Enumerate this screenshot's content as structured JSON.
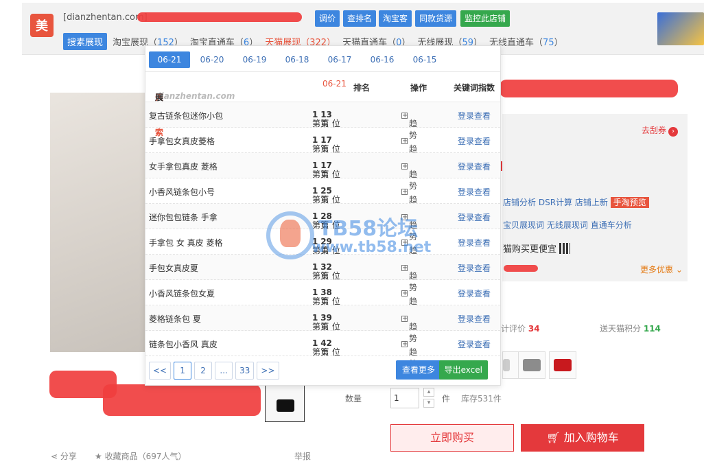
{
  "topbar": {
    "logo_char": "美",
    "domain": "[dianzhentan.com]",
    "buttons": [
      "调价",
      "查排名",
      "淘宝客",
      "同款货源",
      "监控此店铺"
    ],
    "tab_badge": "搜素展现",
    "tabs": [
      {
        "label": "淘宝展现",
        "count": "152"
      },
      {
        "label": "淘宝直通车",
        "count": "6"
      },
      {
        "label": "天猫展现",
        "count": "322",
        "active": true
      },
      {
        "label": "天猫直通车",
        "count": "0"
      },
      {
        "label": "无线展现",
        "count": "59"
      },
      {
        "label": "无线直通车",
        "count": "75"
      }
    ]
  },
  "panel": {
    "dates": [
      "06-21",
      "06-20",
      "06-19",
      "06-18",
      "06-17",
      "06-16",
      "06-15"
    ],
    "selected_date": "06-21",
    "header": {
      "site": "dianzhentan.com",
      "source": "天猫搜索",
      "title_suffix": "展现词",
      "date": "06-21",
      "rank": "排名",
      "action": "操作",
      "index": "关键词指数"
    },
    "rows": [
      {
        "keyword": "复古链条包迷你小包",
        "page": "1",
        "pos": "13"
      },
      {
        "keyword": "手拿包女真皮菱格",
        "page": "1",
        "pos": "17"
      },
      {
        "keyword": "女手拿包真皮 菱格",
        "page": "1",
        "pos": "17"
      },
      {
        "keyword": "小香风链条包小号",
        "page": "1",
        "pos": "25"
      },
      {
        "keyword": "迷你包包链条 手拿",
        "page": "1",
        "pos": "28"
      },
      {
        "keyword": "手拿包 女 真皮 菱格",
        "page": "1",
        "pos": "29"
      },
      {
        "keyword": "手包女真皮夏",
        "page": "1",
        "pos": "32"
      },
      {
        "keyword": "小香风链条包女夏",
        "page": "1",
        "pos": "38"
      },
      {
        "keyword": "菱格链条包 夏",
        "page": "1",
        "pos": "39"
      },
      {
        "keyword": "链条包小香风 真皮",
        "page": "1",
        "pos": "42"
      }
    ],
    "rank_prefix": "第",
    "page_word": "页",
    "pos_prefix": "第",
    "pos_word": "位",
    "trend_label": "趋势",
    "login_label": "登录查看",
    "pager": [
      "<<",
      "1",
      "2",
      "...",
      "33",
      ">>"
    ],
    "more_button": "查看更多",
    "excel_button": "导出excel"
  },
  "product": {
    "coupon": "去刮券",
    "shop_links": [
      "店铺分析",
      "DSR计算",
      "店铺上新"
    ],
    "preview_tag": "手淘预览",
    "shop_links2": [
      "宝贝展现词",
      "无线展现词",
      "直通车分析"
    ],
    "cheap_text": "猫购买更便宜",
    "more_offers": "更多优惠",
    "stats_label": "计评价",
    "stats_value": "34",
    "points_label": "送天猫积分",
    "points_value": "114",
    "qty_label": "数量",
    "qty_value": "1",
    "unit": "件",
    "stock": "库存531件",
    "buy_now": "立即购买",
    "add_cart": "加入购物车",
    "share": "分享",
    "favorite": "收藏商品",
    "popularity": "（697人气）",
    "report": "举报"
  },
  "watermark": {
    "line1": "TB58论坛",
    "line2": "www.tb58.net"
  },
  "colors": {
    "accent_blue": "#3d86df",
    "accent_green": "#35a84d",
    "accent_red": "#e4393c"
  }
}
